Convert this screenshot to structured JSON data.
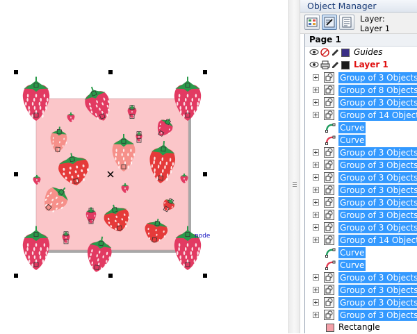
{
  "panel": {
    "title": "Object Manager"
  },
  "layer_info": {
    "label": "Layer:",
    "value": "Layer 1"
  },
  "page": {
    "label": "Page 1"
  },
  "guides": {
    "label": "Guides",
    "color": "#3a2f86"
  },
  "layer1": {
    "label": "Layer 1",
    "color": "#1c1c1c"
  },
  "node_label": "node",
  "objects": [
    {
      "type": "group",
      "label": "Group of 3 Objects"
    },
    {
      "type": "group",
      "label": "Group of 8 Objects"
    },
    {
      "type": "group",
      "label": "Group of 3 Objects"
    },
    {
      "type": "group",
      "label": "Group of 14 Objects"
    },
    {
      "type": "curve",
      "label": "Curve",
      "color": "#1a9a5a"
    },
    {
      "type": "curve",
      "label": "Curve",
      "color": "#e23a50"
    },
    {
      "type": "group",
      "label": "Group of 3 Objects"
    },
    {
      "type": "group",
      "label": "Group of 3 Objects"
    },
    {
      "type": "group",
      "label": "Group of 3 Objects"
    },
    {
      "type": "group",
      "label": "Group of 3 Objects"
    },
    {
      "type": "group",
      "label": "Group of 3 Objects"
    },
    {
      "type": "group",
      "label": "Group of 3 Objects"
    },
    {
      "type": "group",
      "label": "Group of 3 Objects"
    },
    {
      "type": "group",
      "label": "Group of 14 Objects"
    },
    {
      "type": "curve",
      "label": "Curve",
      "color": "#1a9a5a"
    },
    {
      "type": "curve",
      "label": "Curve",
      "color": "#e23a50"
    },
    {
      "type": "group",
      "label": "Group of 3 Objects"
    },
    {
      "type": "group",
      "label": "Group of 3 Objects"
    },
    {
      "type": "group",
      "label": "Group of 3 Objects"
    },
    {
      "type": "group",
      "label": "Group of 3 Objects"
    },
    {
      "type": "rectangle",
      "label": "Rectangle",
      "color": "#f4a0a8"
    }
  ],
  "colors": {
    "background_pink": "#fbc6c9",
    "strawberry_dark": "#e23a62",
    "strawberry_red": "#e53a3a",
    "strawberry_light": "#f6908a",
    "leaf": "#2a9a4a",
    "selection": "#3399ff"
  }
}
